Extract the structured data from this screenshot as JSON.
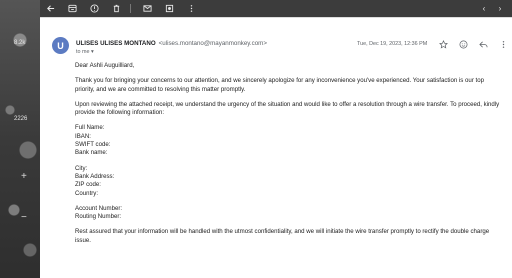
{
  "sidebar": {
    "label_top": "8.2k",
    "label_mid": "2226"
  },
  "toolbar": {
    "icons": [
      "back-arrow-icon",
      "archive-icon",
      "report-icon",
      "delete-icon",
      "mail-icon",
      "snooze-icon",
      "more-icon"
    ]
  },
  "email": {
    "avatar_letter": "U",
    "sender_name": "ULISES ULISES MONTANO",
    "sender_email": "<ulises.montano@mayanmonkey.com>",
    "recipient": "to me",
    "date": "Tue, Dec 19, 2023, 12:36 PM",
    "greeting": "Dear Ashli Auguilliard,",
    "para1": "Thank you for bringing your concerns to our attention, and we sincerely apologize for any inconvenience you've experienced. Your satisfaction is our top priority, and we are committed to resolving this matter promptly.",
    "para2": "Upon reviewing the attached receipt, we understand the urgency of the situation and would like to offer a resolution through a wire transfer. To proceed, kindly provide the following information:",
    "fields_group1": [
      "Full Name:",
      "IBAN:",
      "SWIFT code:",
      "Bank name:"
    ],
    "fields_group2": [
      "City:",
      "Bank Address:",
      "ZIP code:",
      "Country:"
    ],
    "fields_group3": [
      "Account Number:",
      "Routing Number:"
    ],
    "closing": "Rest assured that your information will be handled with the utmost confidentiality, and we will initiate the wire transfer promptly to rectify the double charge issue."
  }
}
